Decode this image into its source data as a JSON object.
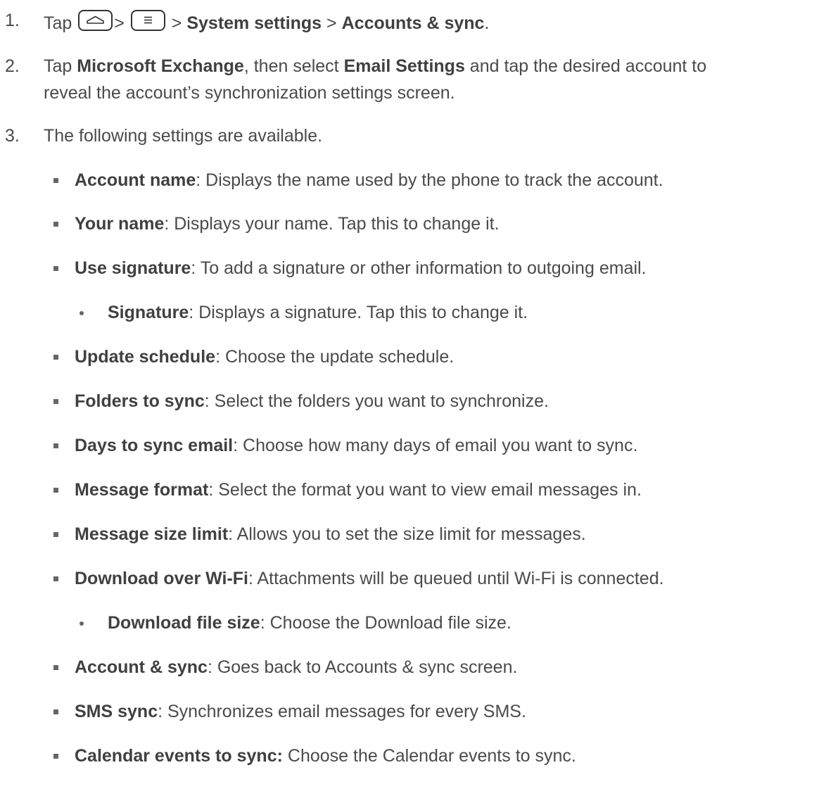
{
  "steps": [
    {
      "num": "1.",
      "parts": {
        "tap": "Tap",
        "sep1": ">",
        "sep2": ">",
        "b1": "System settings",
        "sep3": ">",
        "b2": "Accounts & sync",
        "end": "."
      },
      "icons": [
        "home-key-icon",
        "menu-key-icon"
      ]
    },
    {
      "num": "2.",
      "line1": {
        "t1": "Tap ",
        "b1": "Microsoft Exchange",
        "t2": ", then select ",
        "b2": "Email Settings",
        "t3": " and tap the desired account to"
      },
      "line2": "reveal the account’s synchronization settings screen."
    },
    {
      "num": "3.",
      "text": "The following settings are available."
    }
  ],
  "settings": [
    {
      "name": "Account name",
      "desc": ": Displays the name used by the phone to track the account."
    },
    {
      "name": "Your name",
      "desc": ": Displays your name. Tap this to change it."
    },
    {
      "name": "Use signature",
      "desc": ": To add a signature or other information to outgoing email."
    },
    {
      "name": "Signature",
      "desc": ": Displays a signature. Tap this to change it."
    },
    {
      "name": "Update schedule",
      "desc": ": Choose the update schedule."
    },
    {
      "name": "Folders to sync",
      "desc": ": Select the folders you want to synchronize."
    },
    {
      "name": "Days to sync email",
      "desc": ": Choose how many days of email you want to sync."
    },
    {
      "name": "Message format",
      "desc": ": Select the format you want to view email messages in."
    },
    {
      "name": "Message size limit",
      "desc": ": Allows you to set the size limit for messages."
    },
    {
      "name": "Download over Wi-Fi",
      "desc": ": Attachments will be queued until Wi-Fi is connected."
    },
    {
      "name": "Download file size",
      "desc": ": Choose the Download file size."
    },
    {
      "name": "Account & sync",
      "desc": ": Goes back to Accounts & sync screen."
    },
    {
      "name": "SMS sync",
      "desc": ": Synchronizes email messages for every SMS."
    },
    {
      "name": "Calendar events to sync:",
      "desc": " Choose the Calendar events to sync."
    }
  ]
}
